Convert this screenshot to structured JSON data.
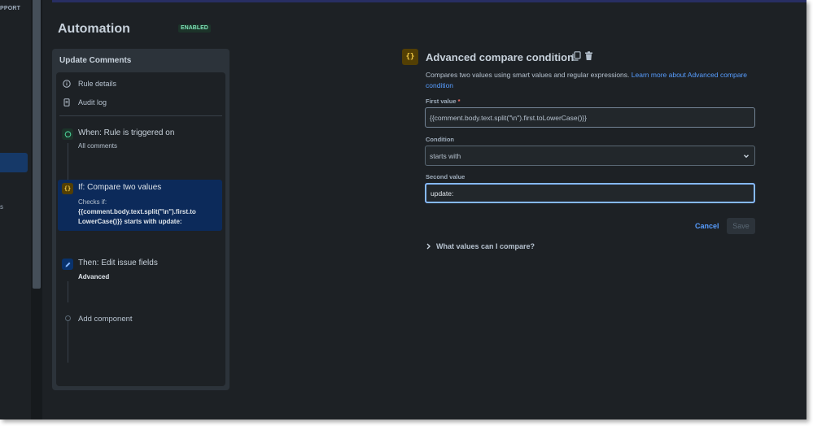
{
  "nav": {
    "support_fragment": "PPORT",
    "item_fragment": "s"
  },
  "header": {
    "title": "Automation",
    "status_badge": "ENABLED"
  },
  "rule": {
    "name": "Update Comments",
    "menu": [
      {
        "label": "Rule details",
        "icon": "info-icon"
      },
      {
        "label": "Audit log",
        "icon": "document-icon"
      }
    ],
    "trigger": {
      "title": "When: Rule is triggered on",
      "desc": "All comments",
      "icon": "comment-trigger-icon"
    },
    "condition": {
      "title": "If: Compare two values",
      "desc_prefix": "Checks if:",
      "desc_line1": "{{comment.body.text.split(\"\\n\").first.to",
      "desc_line2": "LowerCase()}} starts with update:",
      "icon_glyph": "{}"
    },
    "action": {
      "title": "Then: Edit issue fields",
      "desc": "Advanced",
      "icon": "pencil-icon"
    },
    "add_component": "Add component"
  },
  "editor": {
    "icon_glyph": "{}",
    "title": "Advanced compare condition",
    "description": "Compares two values using smart values and regular expressions.",
    "learn_more": "Learn more about Advanced compare condition",
    "first_value_label": "First value",
    "required_mark": "*",
    "first_value": "{{comment.body.text.split(\"\\n\").first.toLowerCase()}}",
    "condition_label": "Condition",
    "condition_value": "starts with",
    "second_value_label": "Second value",
    "second_value": "update:",
    "cancel": "Cancel",
    "save": "Save",
    "help_expander": "What values can I compare?"
  },
  "colors": {
    "accent": "#579dff",
    "selected": "#0c2a5a",
    "badge": "#7ee2b8"
  }
}
